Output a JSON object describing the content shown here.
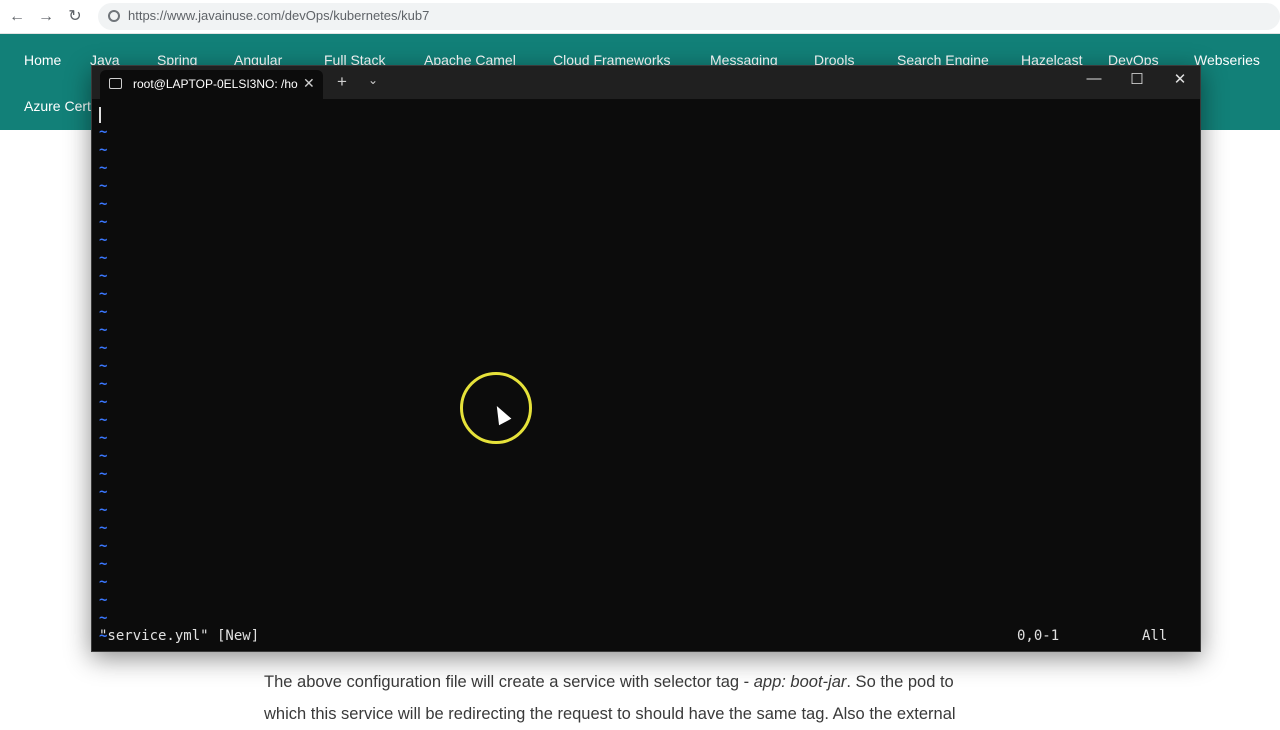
{
  "browser": {
    "url": "https://www.javainuse.com/devOps/kubernetes/kub7",
    "back_icon": "←",
    "forward_icon": "→",
    "reload_icon": "↻"
  },
  "site_nav": {
    "items": [
      "Home",
      "Java",
      "Spring",
      "Angular",
      "Full Stack",
      "Apache Camel",
      "Cloud Frameworks",
      "Messaging",
      "Drools",
      "Search Engine",
      "Hazelcast",
      "DevOps",
      "Webseries"
    ],
    "row2": [
      "Azure Certi"
    ]
  },
  "article": {
    "line1_prefix": "The above configuration file will create a service with selector tag - ",
    "line1_em": "app: boot-jar",
    "line1_suffix": ". So the pod to",
    "line2": "which this service will be redirecting the request to should have the same tag. Also the external"
  },
  "terminal": {
    "tab_title": "root@LAPTOP-0ELSI3NO: /ho",
    "tab_close": "✕",
    "new_tab": "+",
    "tab_menu": "⌄",
    "minimize": "—",
    "maximize": "☐",
    "close": "✕",
    "tilde": "~",
    "status_file": "\"service.yml\" [New]",
    "status_pos": "0,0-1",
    "status_pct": "All"
  },
  "colors": {
    "site_nav_bg": "#128078",
    "terminal_bg": "#0c0c0c",
    "tilde": "#3b78ff",
    "click_ring": "#e6e23a"
  }
}
